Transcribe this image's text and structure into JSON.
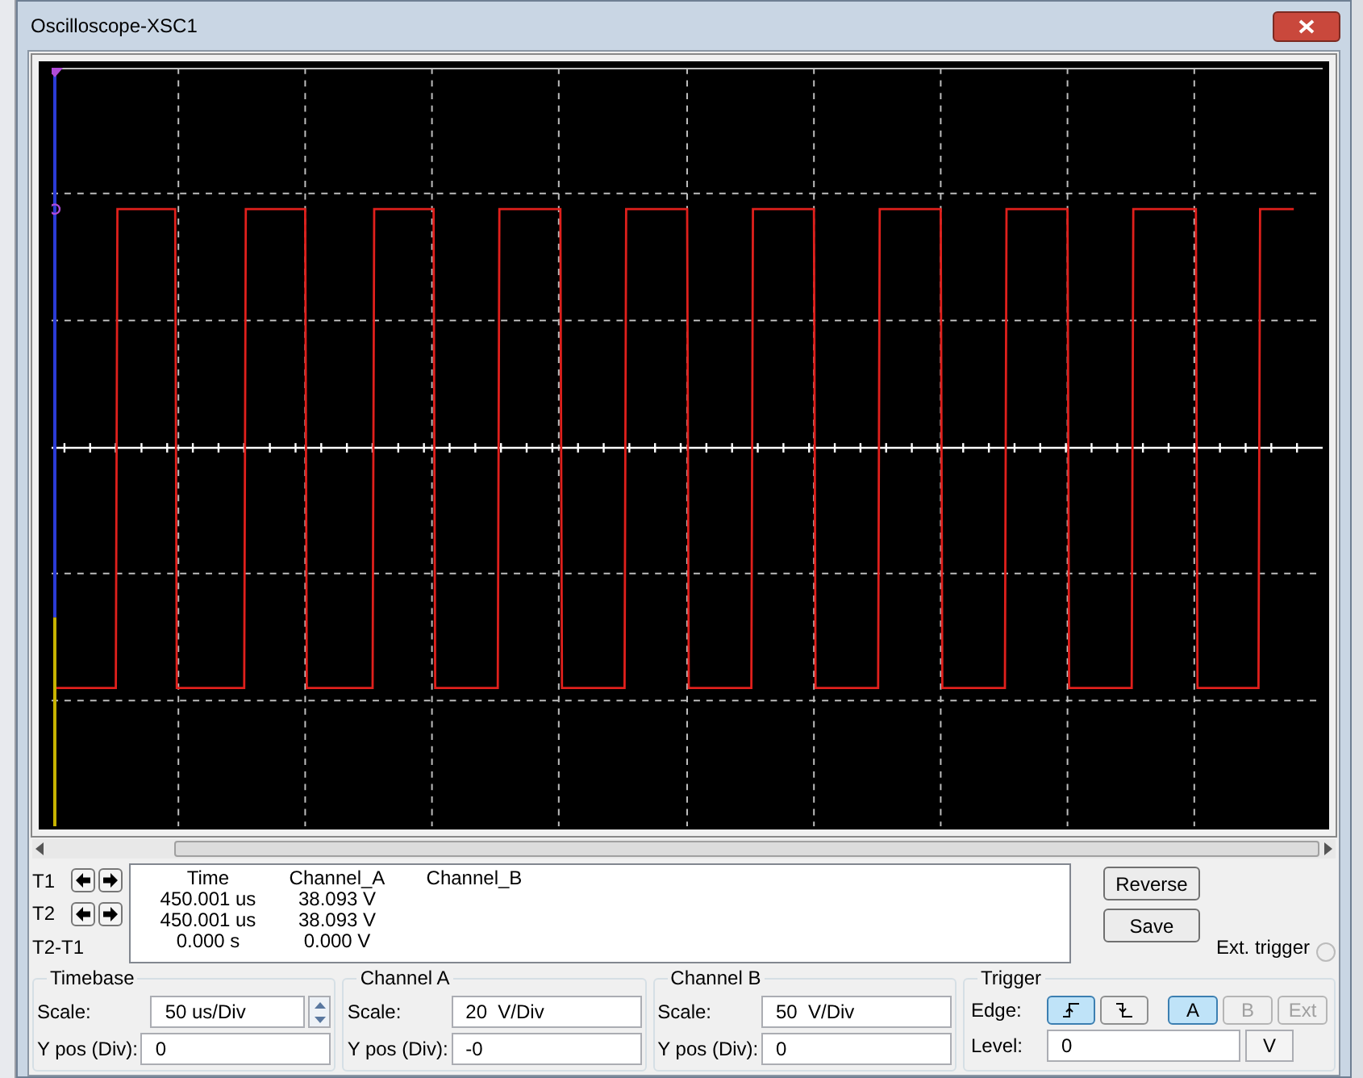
{
  "window": {
    "title": "Oscilloscope-XSC1"
  },
  "readout": {
    "columns": [
      "Time",
      "Channel_A",
      "Channel_B"
    ],
    "rows": [
      {
        "label": "T1",
        "kind": "cursor",
        "cells": [
          "450.001 us",
          "38.093 V"
        ]
      },
      {
        "label": "T2",
        "kind": "cursor",
        "cells": [
          "450.001 us",
          "38.093 V"
        ]
      },
      {
        "label": "T2-T1",
        "kind": "difference",
        "cells": [
          "0.000 s",
          "0.000 V"
        ]
      }
    ]
  },
  "buttons": [
    "Reverse",
    "Save"
  ],
  "ext_trigger": {
    "label": "Ext. trigger",
    "selected": false
  },
  "panels": [
    {
      "kind": "timebase",
      "title": "Timebase",
      "rows": [
        {
          "label": "Scale:",
          "value": "50 us/Div"
        },
        {
          "label": "Y pos (Div):",
          "value": "0"
        }
      ]
    },
    {
      "kind": "channel",
      "title": "Channel A",
      "rows": [
        {
          "label": "Scale:",
          "value": "20  V/Div"
        },
        {
          "label": "Y pos (Div):",
          "value": "-0"
        }
      ]
    },
    {
      "kind": "channel",
      "title": "Channel B",
      "rows": [
        {
          "label": "Scale:",
          "value": "50  V/Div"
        },
        {
          "label": "Y pos (Div):",
          "value": "0"
        }
      ]
    },
    {
      "kind": "trigger",
      "title": "Trigger",
      "edge_label": "Edge:",
      "edges": [
        {
          "kind": "rising",
          "selected": true
        },
        {
          "kind": "falling",
          "selected": false
        }
      ],
      "sources": [
        {
          "label": "A",
          "selected": true,
          "disabled": false
        },
        {
          "label": "B",
          "selected": false,
          "disabled": true
        },
        {
          "label": "Ext",
          "selected": false,
          "disabled": true
        }
      ],
      "level_label": "Level:",
      "level_value": "0",
      "level_unit": "V"
    }
  ]
}
